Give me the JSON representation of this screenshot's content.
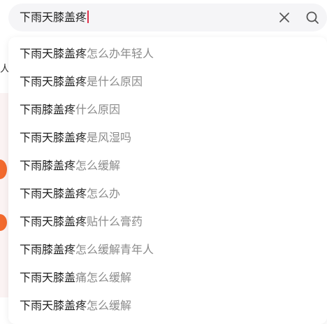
{
  "search": {
    "query": "下雨天膝盖疼",
    "clear_icon": "close-icon",
    "search_icon": "search-icon"
  },
  "suggestions": [
    {
      "match": "下雨天膝盖疼",
      "completion": "怎么办年轻人"
    },
    {
      "match": "下雨天膝盖疼",
      "completion": "是什么原因"
    },
    {
      "match": "下雨膝盖疼",
      "completion": "什么原因"
    },
    {
      "match": "下雨天膝盖疼",
      "completion": "是风湿吗"
    },
    {
      "match": "下雨膝盖疼",
      "completion": "怎么缓解"
    },
    {
      "match": "下雨天膝盖疼",
      "completion": "怎么办"
    },
    {
      "match": "下雨天膝盖疼",
      "completion": "贴什么膏药"
    },
    {
      "match": "下雨膝盖疼",
      "completion": "怎么缓解青年人"
    },
    {
      "match": "下雨天膝盖",
      "completion": "痛怎么缓解"
    },
    {
      "match": "下雨天膝盖疼",
      "completion": "怎么缓解"
    }
  ],
  "colors": {
    "caret": "#e0304a",
    "query_text": "#1f1f1f",
    "completion_text": "#8a8a8a",
    "search_bar_bg": "#f5f5f7",
    "background_accent": "#f26a2e"
  }
}
